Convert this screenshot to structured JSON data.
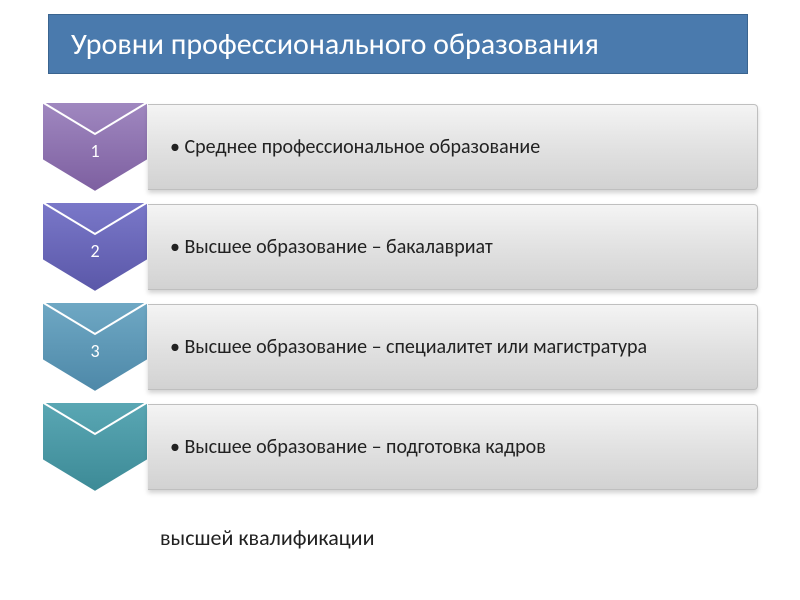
{
  "title": "Уровни профессионального образования",
  "items": [
    {
      "num": "1",
      "text": "• Среднее профессиональное образование",
      "fill1": "#a088c0",
      "fill2": "#7d5fa0"
    },
    {
      "num": "2",
      "text": "• Высшее образование – бакалавриат",
      "fill1": "#7a78c9",
      "fill2": "#5a57a8"
    },
    {
      "num": "3",
      "text": "• Высшее образование – специалитет или магистратура",
      "fill1": "#6fa8c4",
      "fill2": "#4d88a8"
    },
    {
      "num": "",
      "text": "• Высшее образование – подготовка кадров",
      "fill1": "#5aa7b4",
      "fill2": "#3c8a96"
    }
  ],
  "footer": "высшей квалификации"
}
